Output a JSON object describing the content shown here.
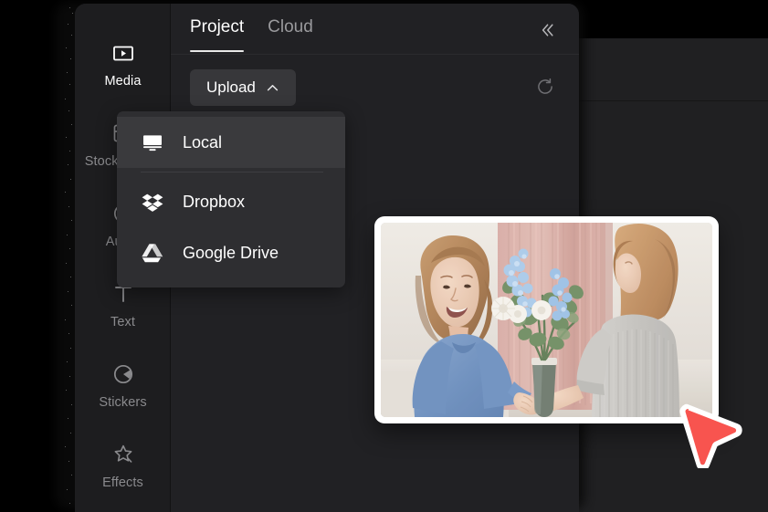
{
  "app": {
    "panel_bg": "#212124",
    "sidebar_bg": "#1d1d1f",
    "menu_bg": "#2e2e31",
    "accent_cursor": "#f8544f"
  },
  "sidebar": {
    "items": [
      {
        "label": "Media",
        "icon": "media-play-rect-icon",
        "active": true
      },
      {
        "label": "Stock videos",
        "icon": "layout-grid-icon",
        "active": false
      },
      {
        "label": "Audio",
        "icon": "music-note-icon",
        "active": false
      },
      {
        "label": "Text",
        "icon": "text-t-icon",
        "active": false
      },
      {
        "label": "Stickers",
        "icon": "sticker-circle-icon",
        "active": false
      },
      {
        "label": "Effects",
        "icon": "sparkle-star-icon",
        "active": false
      }
    ]
  },
  "tabs": [
    {
      "label": "Project",
      "active": true
    },
    {
      "label": "Cloud",
      "active": false
    }
  ],
  "header": {
    "collapse_icon": "double-chevron-left-icon"
  },
  "toolbar": {
    "upload_label": "Upload",
    "upload_chevron": "chevron-up-icon",
    "refresh_icon": "refresh-icon"
  },
  "upload_menu": {
    "open": true,
    "items": [
      {
        "label": "Local",
        "icon": "monitor-icon",
        "hover": true
      },
      {
        "label": "Dropbox",
        "icon": "dropbox-icon",
        "hover": false
      },
      {
        "label": "Google Drive",
        "icon": "google-drive-icon",
        "hover": false
      }
    ]
  },
  "media_thumbnail": {
    "alt": "Two women exchanging a bouquet of blue and white flowers indoors",
    "colors": {
      "wall": "#e6e3de",
      "curtain": "#d9b3ae",
      "blue_sweater": "#6f93c4",
      "grey_sweater": "#c9c8c6",
      "hair": "#b98a5e",
      "foliage": "#6f8b63",
      "petals": "#a8c8e8"
    }
  },
  "cursor": {
    "icon": "arrow-cursor-icon",
    "color": "#f8544f"
  }
}
